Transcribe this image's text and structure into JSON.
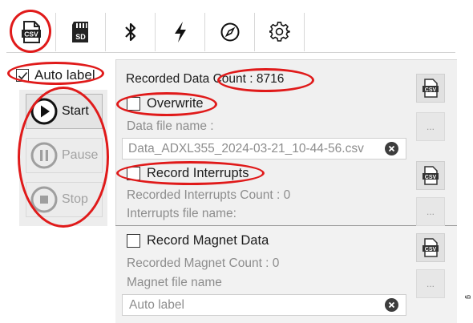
{
  "tabs": [
    {
      "icon": "csv-file-icon",
      "label": "CSV",
      "selected": true
    },
    {
      "icon": "sd-card-icon",
      "label": "SD"
    },
    {
      "icon": "bluetooth-icon"
    },
    {
      "icon": "lightning-icon"
    },
    {
      "icon": "compass-icon"
    },
    {
      "icon": "gear-icon"
    }
  ],
  "left": {
    "auto_label": {
      "label": "Auto label",
      "checked": true
    },
    "start_label": "Start",
    "pause_label": "Pause",
    "stop_label": "Stop"
  },
  "data_section": {
    "recorded_prefix": "Recorded Data ",
    "count_text": "Count : 8716",
    "overwrite_label": "Overwrite",
    "file_name_label": "Data file name :",
    "file_name_value": "Data_ADXL355_2024-03-21_10-44-56.csv"
  },
  "interrupts_section": {
    "record_label": "Record Interrupts",
    "count_text": "Recorded Interrupts Count : 0",
    "file_name_label": "Interrupts file name:"
  },
  "magnet_section": {
    "record_label": "Record Magnet Data",
    "count_text": "Recorded Magnet Count : 0",
    "file_name_label": "Magnet file name",
    "file_name_value": "Auto label"
  },
  "side_buttons": {
    "csv_label": "CSV",
    "browse_label": "..."
  },
  "edge_text": "g",
  "colors": {
    "highlight": "#e01a1a",
    "panel_bg": "#f0f0f0",
    "disabled_text": "#8d8d8d"
  }
}
